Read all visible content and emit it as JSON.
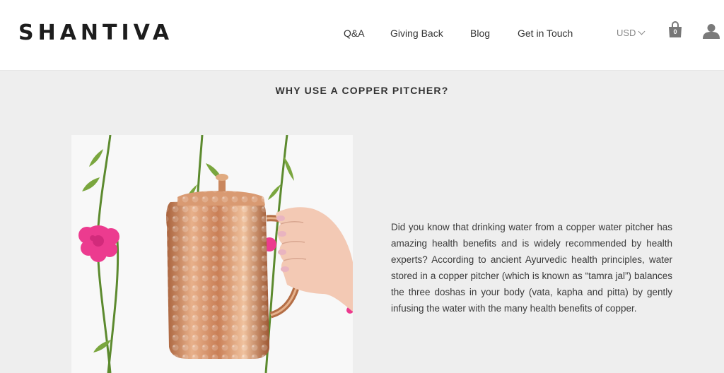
{
  "header": {
    "logo": "SHANTIVA",
    "nav": [
      {
        "label": "Q&A"
      },
      {
        "label": "Giving Back"
      },
      {
        "label": "Blog"
      },
      {
        "label": "Get in Touch"
      }
    ],
    "currency": "USD",
    "cart_count": "0",
    "icons": {
      "cart": "shopping-bag-icon",
      "account": "user-icon",
      "currency_dropdown": "chevron-down-icon"
    }
  },
  "main": {
    "title": "WHY USE A COPPER PITCHER?",
    "image": {
      "subject": "copper-pitcher-photo"
    },
    "paragraph": "Did you know that drinking water from a copper water pitcher has amazing health benefits and is widely recommended by health experts? According to ancient Ayurvedic health principles, water stored in a copper pitcher (which is known as “tamra jal”) balances the three doshas in your body (vata, kapha and pitta) by gently infusing the water with the many health benefits of copper."
  },
  "colors": {
    "background": "#eeeeee",
    "header": "#ffffff",
    "copper": "#c9805a",
    "flower": "#ec3b8f",
    "stem": "#5c8a2e"
  }
}
